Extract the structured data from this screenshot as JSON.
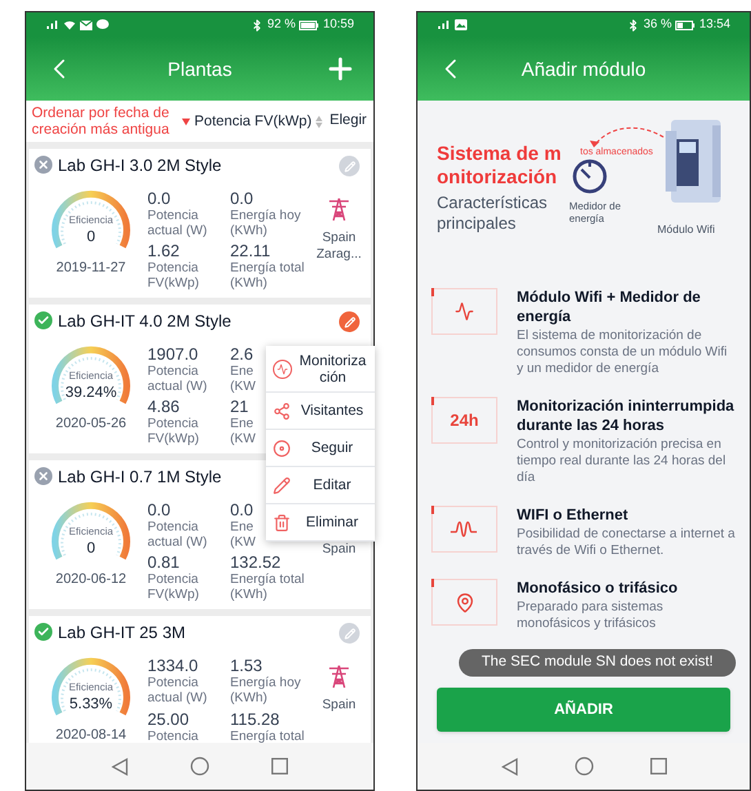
{
  "left_screen": {
    "status_bar": {
      "battery": "92 %",
      "time": "10:59"
    },
    "header": {
      "title": "Plantas"
    },
    "sort_bar": {
      "options": [
        {
          "label": "Ordenar por fecha de creación más antigua",
          "selected": true
        },
        {
          "label": "Potencia FV(kWp)",
          "selected": false
        }
      ],
      "filter": "Elegir"
    },
    "plants": [
      {
        "name": "Lab GH-I 3.0 2M Style",
        "online": false,
        "selected": false,
        "efficiency_label": "Eficiencia",
        "efficiency": "0",
        "date": "2019-11-27",
        "metrics": [
          {
            "value": "0.0",
            "label": "Potencia\nactual (W)"
          },
          {
            "value": "0.0",
            "label": "Energía hoy\n(KWh)"
          },
          {
            "value": "1.62",
            "label": "Potencia\nFV(kWp)"
          },
          {
            "value": "22.11",
            "label": "Energía total\n(KWh)"
          }
        ],
        "grid_icon": true,
        "location": "Spain Zarag..."
      },
      {
        "name": "Lab GH-IT 4.0 2M Style",
        "online": true,
        "selected": true,
        "efficiency_label": "Eficiencia",
        "efficiency": "39.24%",
        "date": "2020-05-26",
        "metrics": [
          {
            "value": "1907.0",
            "label": "Potencia\nactual (W)"
          },
          {
            "value": "2.6",
            "label": "Ene\n(KW"
          },
          {
            "value": "4.86",
            "label": "Potencia\nFV(kWp)"
          },
          {
            "value": "21",
            "label": "Ene\n(KW"
          }
        ]
      },
      {
        "name": "Lab GH-I 0.7 1M Style",
        "online": false,
        "efficiency_label": "Eficiencia",
        "efficiency": "0",
        "date": "2020-06-12",
        "metrics": [
          {
            "value": "0.0",
            "label": "Potencia\nactual (W)"
          },
          {
            "value": "0.0",
            "label": "Ene\n(KW"
          },
          {
            "value": "0.81",
            "label": "Potencia\nFV(kWp)"
          },
          {
            "value": "132.52",
            "label": "Energía total\n(KWh)"
          }
        ],
        "location": "Spain"
      },
      {
        "name": "Lab GH-IT 25 3M",
        "online": true,
        "selected": false,
        "efficiency_label": "Eficiencia",
        "efficiency": "5.33%",
        "date": "2020-08-14",
        "metrics": [
          {
            "value": "1334.0",
            "label": "Potencia\nactual (W)"
          },
          {
            "value": "1.53",
            "label": "Energía hoy\n(KWh)"
          },
          {
            "value": "25.00",
            "label": "Potencia"
          },
          {
            "value": "115.28",
            "label": "Energía total"
          }
        ],
        "grid_icon": true,
        "location": "Spain"
      }
    ],
    "menu": [
      {
        "kind": "monitor",
        "label": "Monitorización"
      },
      {
        "kind": "share",
        "label": "Visitantes"
      },
      {
        "kind": "follow",
        "label": "Seguir"
      },
      {
        "kind": "edit",
        "label": "Editar"
      },
      {
        "kind": "delete",
        "label": "Eliminar"
      }
    ]
  },
  "right_screen": {
    "status_bar": {
      "battery": "36 %",
      "time": "13:54"
    },
    "header": {
      "title": "Añadir módulo"
    },
    "hero": {
      "title": "Sistema de monitorización",
      "subtitle": "Características principales",
      "meter_label": "Medidor de energía",
      "flow_label": "tos almacenados",
      "module_label": "Módulo Wifi"
    },
    "features": [
      {
        "kind": "pulse",
        "title": "Módulo Wifi + Medidor de energía",
        "description": "El sistema de monitorización de consumos consta de un módulo Wifi y un medidor de energía"
      },
      {
        "kind": "text",
        "icon_text": "24h",
        "title": "Monitorización ininterrumpida durante las 24 horas",
        "description": "Control y monitorización precisa en tiempo real durante las 24 horas del día"
      },
      {
        "kind": "signal",
        "title": "WIFI o Ethernet",
        "description": "Posibilidad de conectarse a internet a través de Wifi o Ethernet."
      },
      {
        "kind": "pin",
        "title": "Monofásico o trifásico",
        "description": "Preparado para sistemas monofásicos y trifásicos"
      }
    ],
    "toast": "The SEC module SN does not exist!",
    "button": "AÑADIR"
  }
}
